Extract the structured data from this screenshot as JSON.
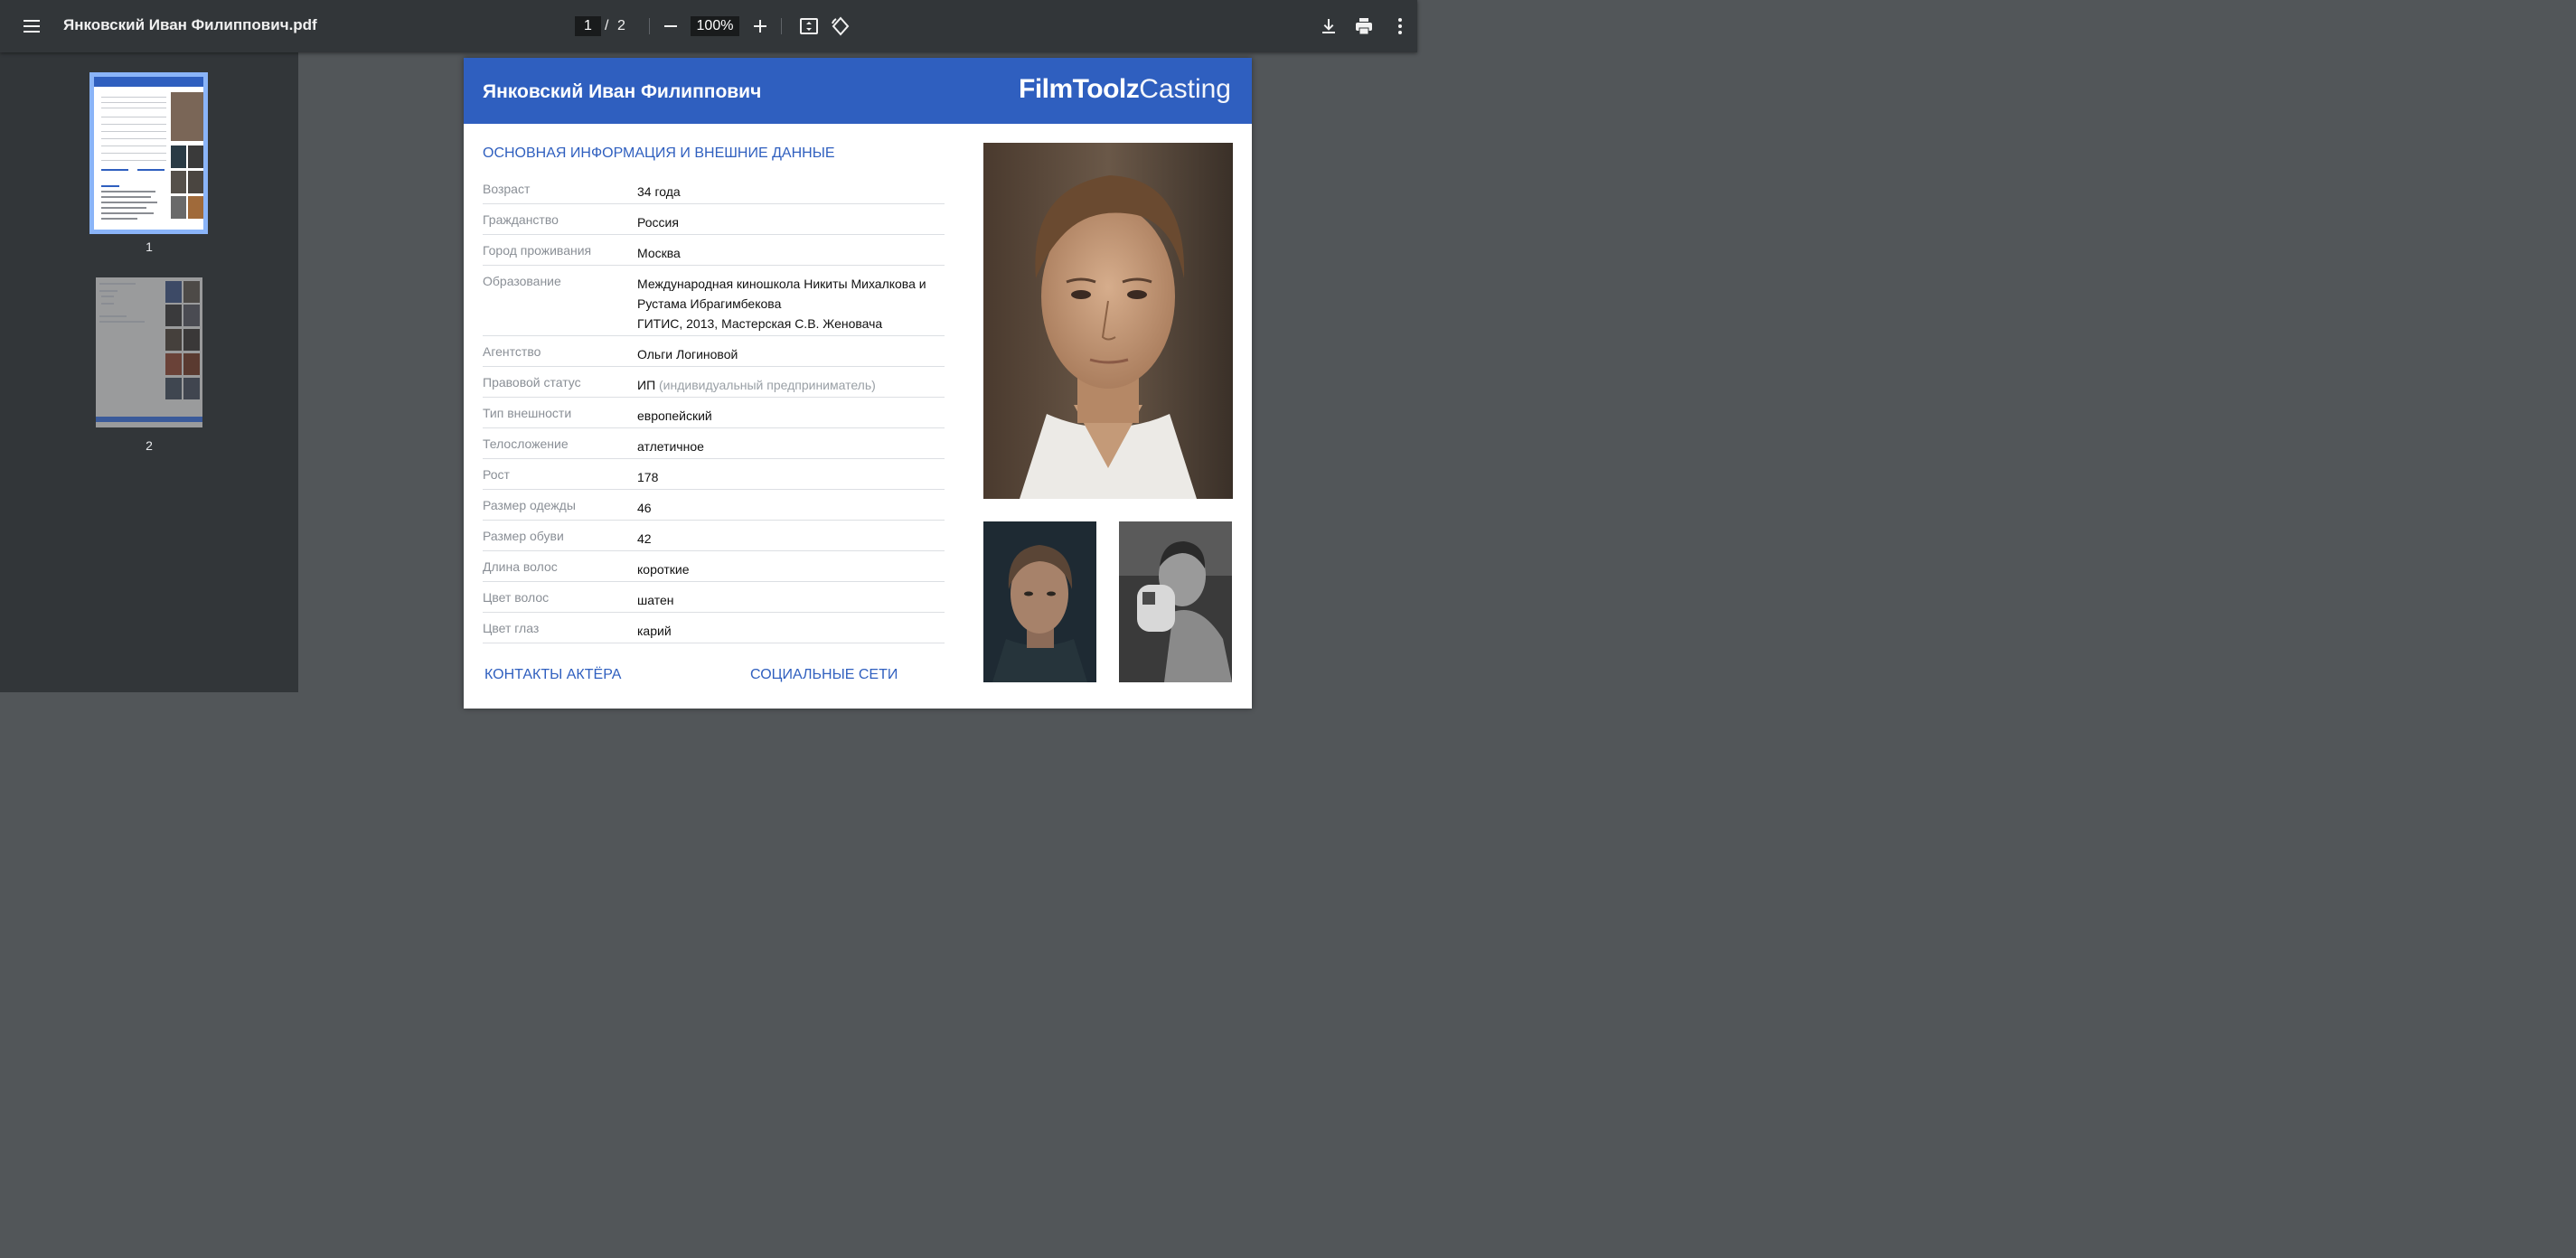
{
  "toolbar": {
    "title": "Янковский Иван Филиппович.pdf",
    "current_page": "1",
    "slash": "/",
    "total_pages": "2",
    "zoom": "100%"
  },
  "icons": {
    "menu": "hamburger-menu-icon",
    "zoom_out": "minus-icon",
    "zoom_in": "plus-icon",
    "fit": "fit-to-page-icon",
    "rotate": "rotate-counterclockwise-icon",
    "download": "download-icon",
    "print": "print-icon",
    "more": "more-vert-icon"
  },
  "sidebar": {
    "thumbnails": [
      {
        "label": "1",
        "selected": true
      },
      {
        "label": "2",
        "selected": false
      }
    ]
  },
  "document": {
    "actor_name": "Янковский Иван Филиппович",
    "brand_bold": "FilmToolz",
    "brand_light": "Casting",
    "section_main": "ОСНОВНАЯ ИНФОРМАЦИЯ И ВНЕШНИЕ ДАННЫЕ",
    "section_contacts": "КОНТАКТЫ АКТЁРА",
    "section_social": "СОЦИАЛЬНЫЕ СЕТИ",
    "rows": [
      {
        "label": "Возраст",
        "value": "34 года"
      },
      {
        "label": "Гражданство",
        "value": "Россия"
      },
      {
        "label": "Город проживания",
        "value": "Москва"
      },
      {
        "label": "Образование",
        "value": "Международная киношкола Никиты Михалкова и Рустама Ибрагимбекова",
        "value2": "ГИТИС, 2013, Мастерская С.В. Женовача"
      },
      {
        "label": "Агентство",
        "value": "Ольги Логиновой"
      },
      {
        "label": "Правовой статус",
        "value": "ИП",
        "note": "(индивидуальный предприниматель)"
      },
      {
        "label": "Тип внешности",
        "value": "европейский"
      },
      {
        "label": "Телосложение",
        "value": "атлетичное"
      },
      {
        "label": "Рост",
        "value": "178"
      },
      {
        "label": "Размер одежды",
        "value": "46"
      },
      {
        "label": "Размер обуви",
        "value": "42"
      },
      {
        "label": "Длина волос",
        "value": "короткие"
      },
      {
        "label": "Цвет волос",
        "value": "шатен"
      },
      {
        "label": "Цвет глаз",
        "value": "карий"
      }
    ]
  },
  "colors": {
    "toolbar": "#323639",
    "viewer_bg": "#525659",
    "header_blue": "#2f5fbf",
    "thumb_selected": "#8ab4f8"
  }
}
